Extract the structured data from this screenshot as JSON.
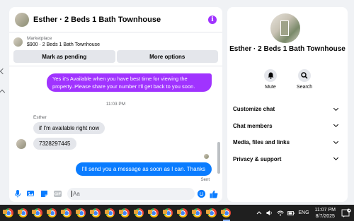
{
  "chat": {
    "title": "Esther · 2 Beds 1 Bath Townhouse",
    "listing": {
      "source": "Marketplace",
      "description": "$900 · 2 Beds 1 Bath Townhouse",
      "primary_button": "Mark as pending",
      "secondary_button": "More options"
    },
    "messages": {
      "outgoing_1": "Yes it's Available when you have best time for viewing the property..Please share your number I'll get back to you soon.",
      "timestamp": "11:03 PM",
      "sender_name": "Esther",
      "incoming_1": "if I'm available right now",
      "incoming_2": "7328297445",
      "outgoing_2": "I'll send you a message as soon as I can. Thanks",
      "status": "Sent"
    },
    "composer": {
      "placeholder": "Aa"
    }
  },
  "sidebar": {
    "name": "Esther · 2 Beds 1 Bath Townhouse",
    "actions": [
      {
        "label": "Mute",
        "icon": "bell-icon"
      },
      {
        "label": "Search",
        "icon": "search-icon"
      }
    ],
    "menu": [
      {
        "label": "Customize chat"
      },
      {
        "label": "Chat members"
      },
      {
        "label": "Media, files and links"
      },
      {
        "label": "Privacy & support"
      }
    ]
  },
  "taskbar": {
    "lang": "ENG",
    "time": "11:07 PM",
    "date": "8/7/2025",
    "notification_count": "2"
  },
  "colors": {
    "accent_purple": "#a033ff",
    "accent_blue": "#0a7cff"
  }
}
